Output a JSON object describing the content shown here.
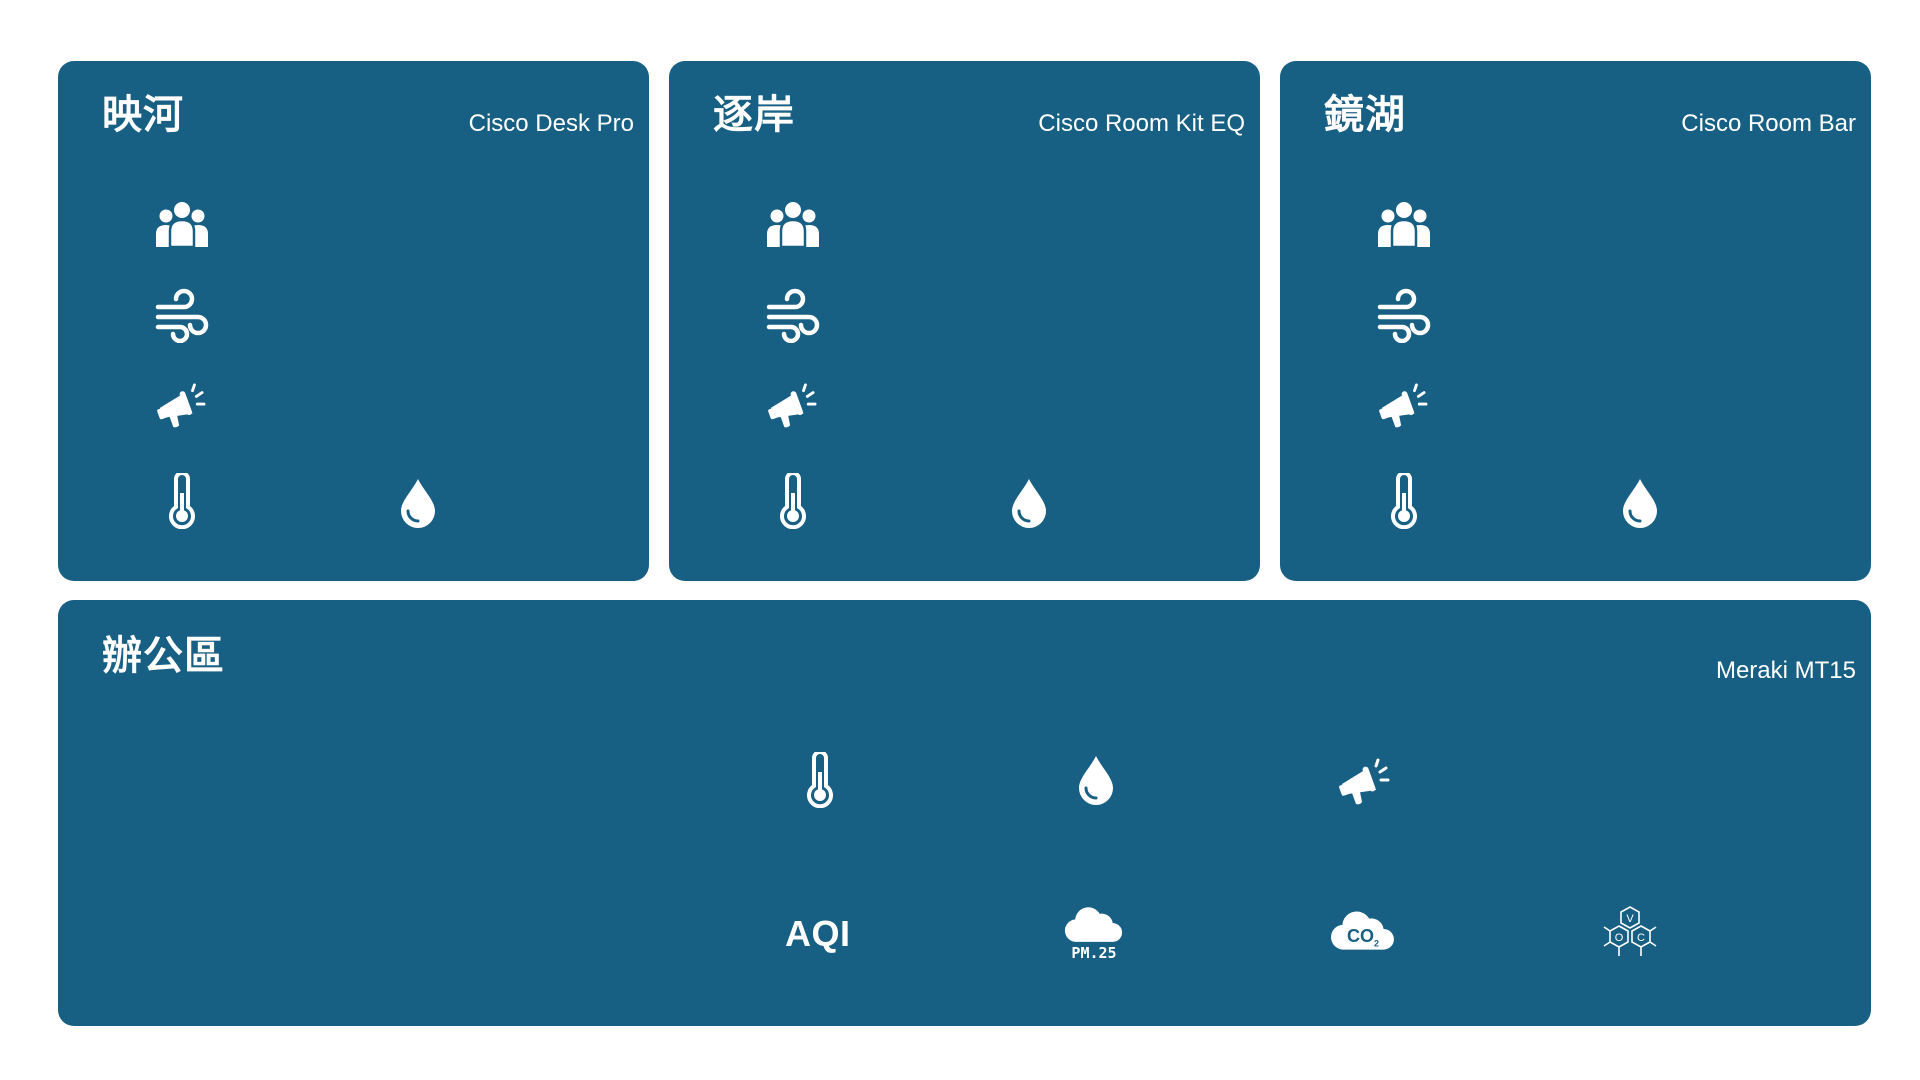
{
  "rooms": [
    {
      "name": "映河",
      "device": "Cisco Desk Pro",
      "sensors": [
        "people-count-icon",
        "air-flow-icon",
        "noise-level-icon",
        "temperature-icon",
        "humidity-icon"
      ]
    },
    {
      "name": "逐岸",
      "device": "Cisco Room Kit EQ",
      "sensors": [
        "people-count-icon",
        "air-flow-icon",
        "noise-level-icon",
        "temperature-icon",
        "humidity-icon"
      ]
    },
    {
      "name": "鏡湖",
      "device": "Cisco Room Bar",
      "sensors": [
        "people-count-icon",
        "air-flow-icon",
        "noise-level-icon",
        "temperature-icon",
        "humidity-icon"
      ]
    }
  ],
  "office": {
    "name": "辦公區",
    "device": "Meraki MT15",
    "sensors": [
      "temperature-icon",
      "humidity-icon",
      "noise-level-icon",
      "aqi-icon",
      "pm25-icon",
      "co2-icon",
      "voc-icon"
    ],
    "aqi_label": "AQI",
    "pm25_label": "PM.25",
    "co2_label": "CO",
    "co2_sub": "2",
    "voc_letters": [
      "V",
      "O",
      "C"
    ]
  },
  "colors": {
    "panel": "#186083",
    "background": "#ffffff",
    "foreground": "#ffffff"
  }
}
